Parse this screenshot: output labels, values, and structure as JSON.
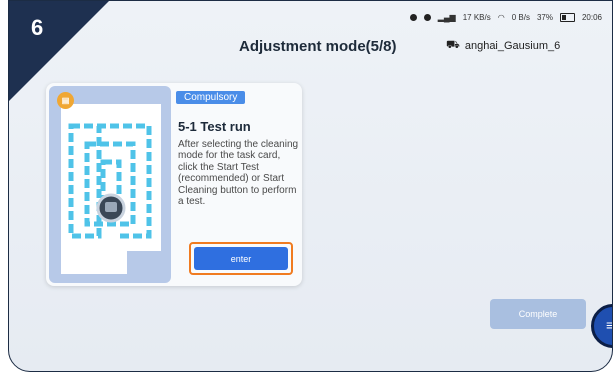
{
  "step_badge": "6",
  "header": {
    "title": "Adjustment mode(5/8)",
    "robot_name": "anghai_Gausium_6"
  },
  "status_bar": {
    "net_speed_1": "17 KB/s",
    "net_speed_2": "0 B/s",
    "battery": "37%",
    "time": "20:06"
  },
  "card": {
    "tag": "Compulsory",
    "title": "5-1  Test run",
    "description": "After selecting the cleaning mode for the task card, click the Start Test (recommended) or Start Cleaning button to perform a test.",
    "button": "enter"
  },
  "complete_button": "Complete",
  "colors": {
    "accent": "#2f6fe0",
    "highlight": "#f07b20",
    "corner": "#1e3050"
  }
}
